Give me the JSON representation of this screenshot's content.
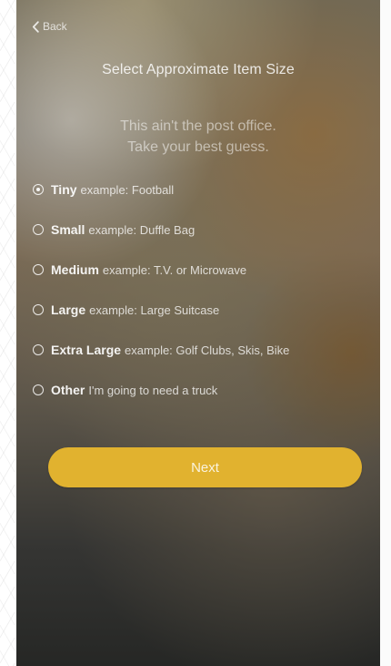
{
  "nav": {
    "back_label": "Back",
    "back_icon": "chevron-left-icon"
  },
  "header": {
    "title": "Select Approximate Item Size"
  },
  "subtitle": {
    "line1": "This ain't the post office.",
    "line2": "Take your best guess."
  },
  "size_options": [
    {
      "name": "Tiny",
      "description": "example: Football",
      "selected": true
    },
    {
      "name": "Small",
      "description": "example: Duffle Bag",
      "selected": false
    },
    {
      "name": "Medium",
      "description": "example: T.V. or Microwave",
      "selected": false
    },
    {
      "name": "Large",
      "description": "example: Large Suitcase",
      "selected": false
    },
    {
      "name": "Extra Large",
      "description": "example: Golf Clubs, Skis, Bike",
      "selected": false
    },
    {
      "name": "Other",
      "description": "I'm going to need a truck",
      "selected": false
    }
  ],
  "actions": {
    "next_label": "Next"
  },
  "colors": {
    "primary_button": "#e1b22f",
    "text": "#ffffff"
  }
}
